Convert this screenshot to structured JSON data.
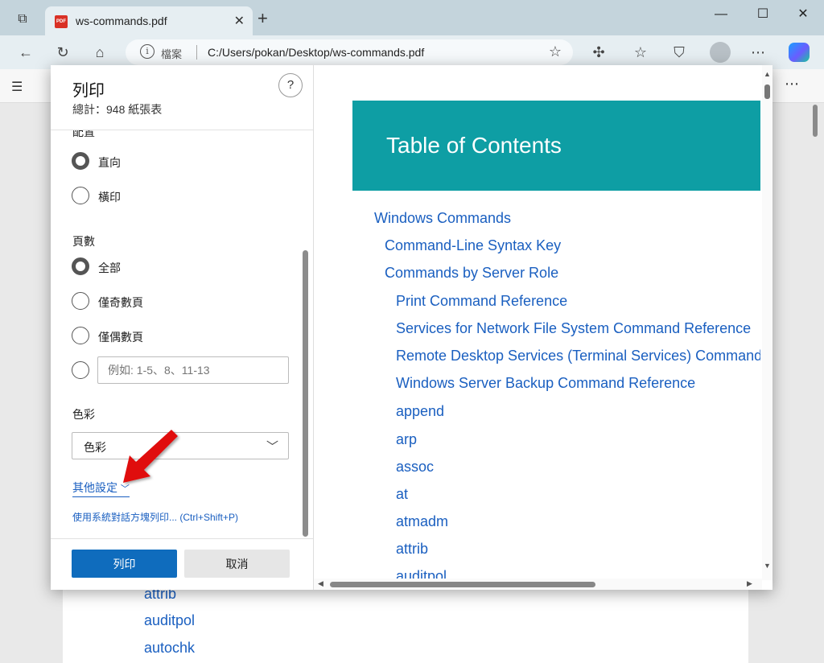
{
  "browser": {
    "tab_title": "ws-commands.pdf",
    "tab_favicon": "PDF",
    "address_label": "檔案",
    "address_url": "C:/Users/pokan/Desktop/ws-commands.pdf"
  },
  "print_dialog": {
    "title": "列印",
    "subtitle": "總計：948 紙張表",
    "help": "?",
    "orientation_label": "配置",
    "orientation_options": [
      "直向",
      "橫印"
    ],
    "pages_label": "頁數",
    "pages_options": [
      "全部",
      "僅奇數頁",
      "僅偶數頁"
    ],
    "custom_range_placeholder": "例如: 1-5、8、11-13",
    "color_label": "色彩",
    "color_value": "色彩",
    "more_settings": "其他設定",
    "system_dialog": "使用系統對話方塊列印... (Ctrl+Shift+P)",
    "print_button": "列印",
    "cancel_button": "取消"
  },
  "preview": {
    "banner_title": "Table of Contents",
    "items": [
      "Windows Commands",
      "Command-Line Syntax Key",
      "Commands by Server Role",
      "Print Command Reference",
      "Services for Network File System Command Reference",
      "Remote Desktop Services (Terminal Services) Command Reference",
      "Windows Server Backup Command Reference",
      "append",
      "arp",
      "assoc",
      "at",
      "atmadm",
      "attrib",
      "auditpol"
    ]
  },
  "background_page": {
    "items": [
      "attrib",
      "auditpol",
      "autochk"
    ]
  },
  "colors": {
    "accent": "#0f6cbd",
    "link": "#1a5fc0",
    "banner": "#0e9ea4",
    "annotation_arrow": "#e01010"
  }
}
